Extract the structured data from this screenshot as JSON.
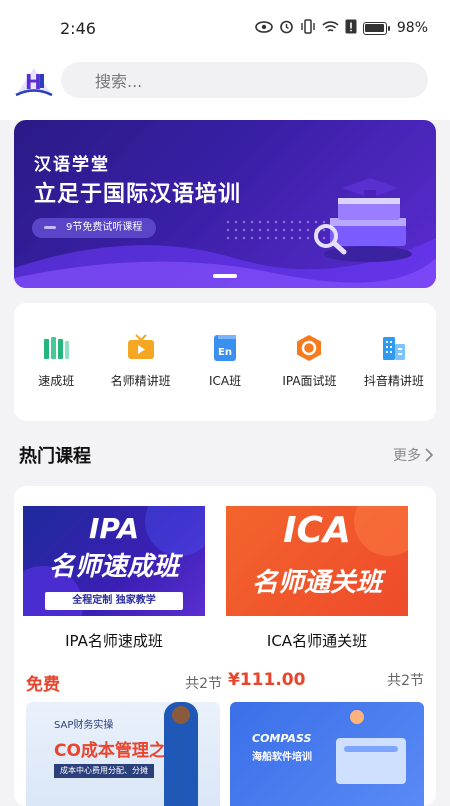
{
  "status_bar": {
    "time": "2:46",
    "battery": "98%",
    "battery_level": 0.98
  },
  "header": {
    "logo_text": "H",
    "search_placeholder": "搜索..."
  },
  "banner": {
    "title_small": "汉语学堂",
    "title_large": "立足于国际汉语培训",
    "pill": "9节免费试听课程",
    "colors": {
      "bg_start": "#2a1a86",
      "bg_end": "#5b2cd0",
      "wave": "#6f3cff"
    }
  },
  "categories": [
    {
      "label": "速成班",
      "icon": "books-icon",
      "color": "#25b67e"
    },
    {
      "label": "名师精讲班",
      "icon": "tv-icon",
      "color": "#f5a623"
    },
    {
      "label": "ICA班",
      "icon": "en-doc-icon",
      "color": "#3a8ff0"
    },
    {
      "label": "IPA面试班",
      "icon": "hexagon-icon",
      "color": "#f77b1c"
    },
    {
      "label": "抖音精讲班",
      "icon": "buildings-icon",
      "color": "#2f9bef"
    }
  ],
  "hot_courses": {
    "title": "热门课程",
    "more": "更多",
    "items": [
      {
        "name": "IPA名师速成班",
        "thumb_line1": "IPA",
        "thumb_line2": "名师速成班",
        "thumb_tag": "全程定制 独家教学",
        "price": "免费",
        "lessons": "共2节"
      },
      {
        "name": "ICA名师通关班",
        "thumb_line1": "ICA",
        "thumb_line2": "名师通关班",
        "price": "¥111.00",
        "lessons": "共2节"
      }
    ],
    "next_row": [
      {
        "thumb_top": "SAP财务实操",
        "thumb_title": "CO成本管理之",
        "thumb_sub": "成本中心费用分配、分摊"
      },
      {
        "thumb_title": "COMPASS",
        "thumb_sub": "海船软件培训"
      }
    ]
  },
  "colors": {
    "accent": "#e8452c",
    "page_bg": "#f3f3f5"
  }
}
